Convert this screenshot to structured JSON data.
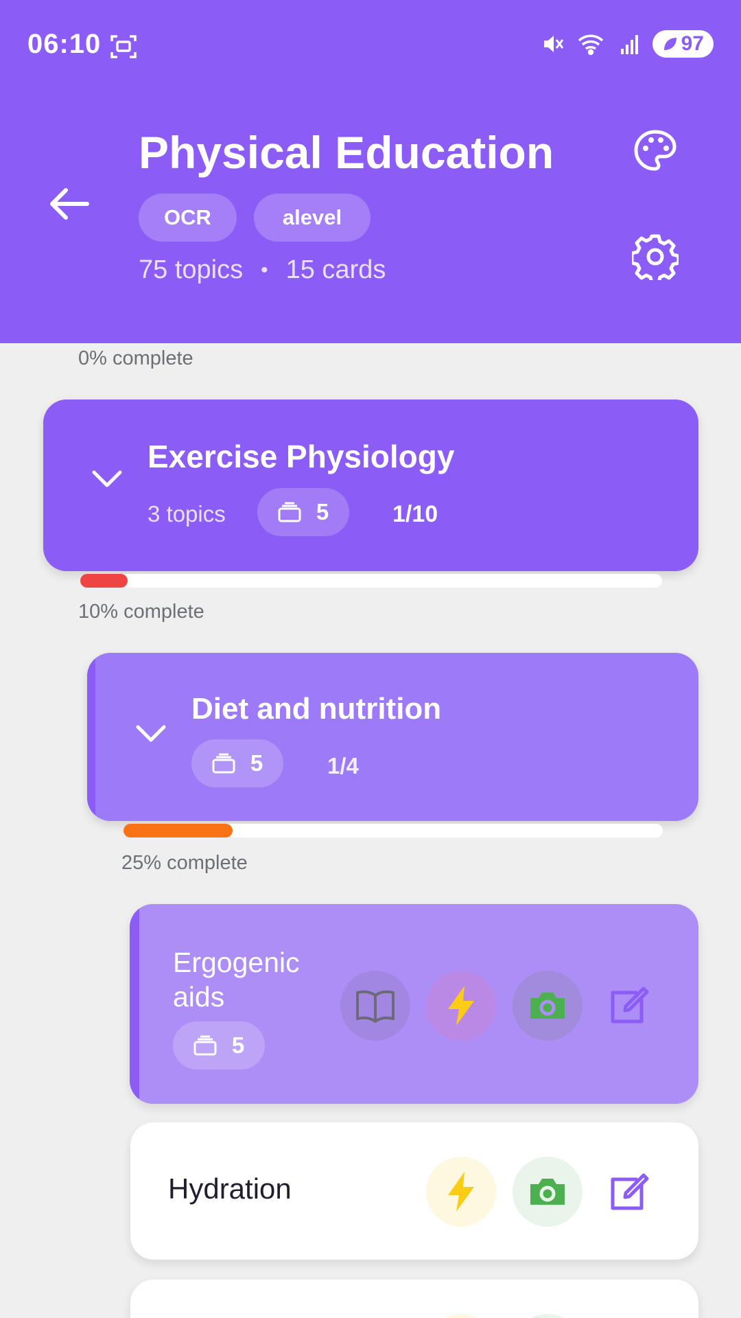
{
  "status_bar": {
    "time": "06:10",
    "battery": "97"
  },
  "header": {
    "title": "Physical Education",
    "tags": [
      "OCR",
      "alevel"
    ],
    "topics": "75 topics",
    "separator": "•",
    "cards": "15 cards"
  },
  "root_progress": {
    "label": "0% complete"
  },
  "unit": {
    "title": "Exercise Physiology",
    "topics": "3 topics",
    "card_count": "5",
    "ratio": "1/10",
    "progress_label": "10% complete",
    "progress_fraction": 0.1,
    "progress_color": "#ef4444"
  },
  "subtopic": {
    "title": "Diet and nutrition",
    "card_count": "5",
    "ratio": "1/4",
    "progress_label": "25% complete",
    "progress_fraction": 0.25,
    "progress_color": "#f97316"
  },
  "topics": [
    {
      "title_line1": "Ergogenic",
      "title_line2": "aids",
      "card_count": "5"
    },
    {
      "title": "Hydration"
    }
  ],
  "colors": {
    "brand": "#8b5cf6",
    "lightning": "#facc15",
    "camera": "#4caf50"
  }
}
